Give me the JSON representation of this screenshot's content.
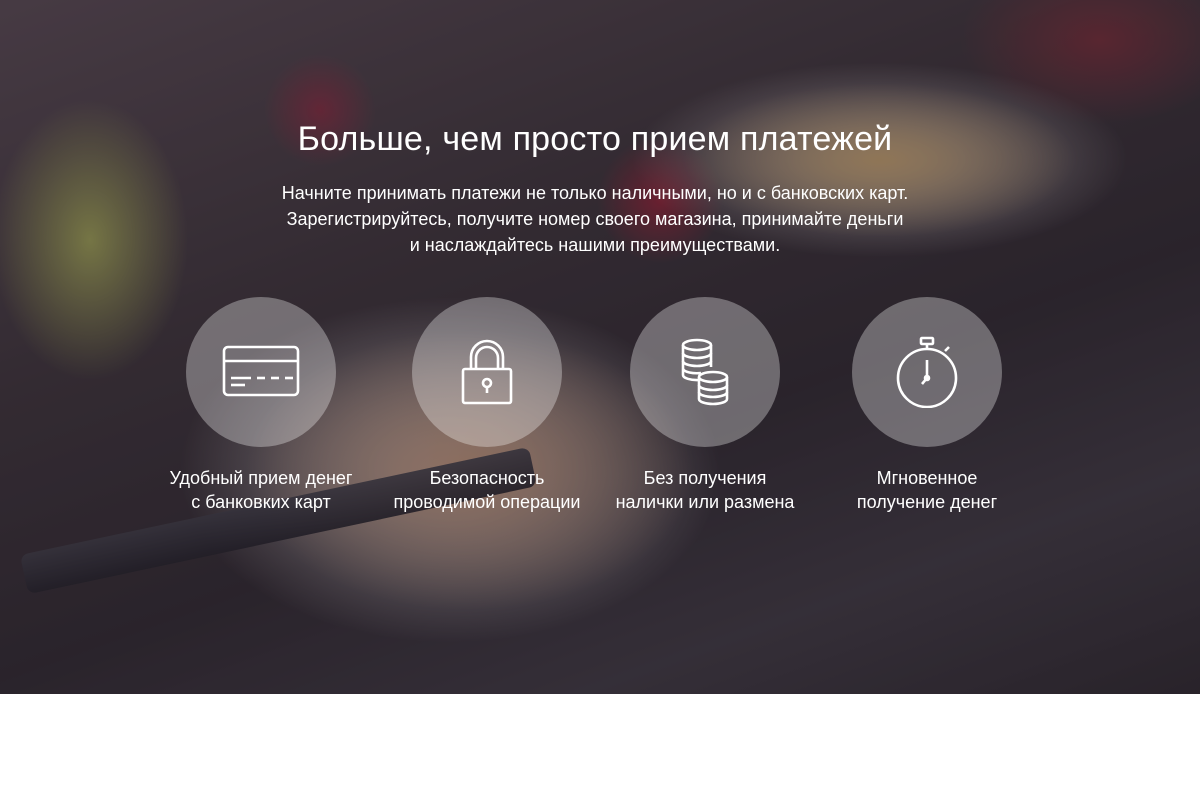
{
  "hero": {
    "title": "Больше, чем просто прием платежей",
    "subtitle_lines": [
      "Начните принимать платежи не только наличными, но и с банковских карт.",
      "Зарегистрируйтесь, получите номер своего магазина, принимайте деньги",
      "и наслаждайтесь нашими преимуществами."
    ]
  },
  "features": [
    {
      "icon": "credit-card-icon",
      "lines": [
        "Удобный прием денег",
        "с банковких карт"
      ]
    },
    {
      "icon": "padlock-icon",
      "lines": [
        "Безопасность",
        "проводимой операции"
      ]
    },
    {
      "icon": "coins-icon",
      "lines": [
        "Без получения",
        "налички или размена"
      ]
    },
    {
      "icon": "stopwatch-icon",
      "lines": [
        "Мгновенное",
        "получение денег"
      ]
    }
  ],
  "colors": {
    "text": "#ffffff",
    "circle_fill": "rgba(255,255,255,0.32)",
    "page_background": "#ffffff"
  }
}
